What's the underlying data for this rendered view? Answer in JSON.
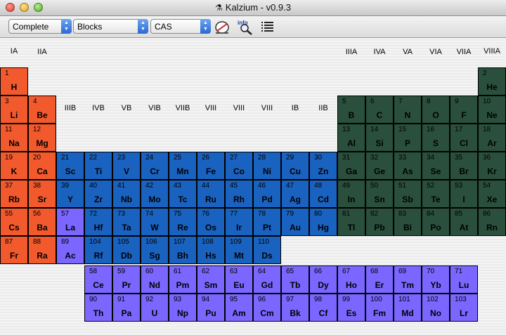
{
  "window": {
    "title": "Kalzium - v0.9.3"
  },
  "toolbar": {
    "select1": "Complete",
    "select2": "Blocks",
    "select3": "CAS",
    "icons": [
      "calculator-icon",
      "info-search-icon",
      "list-icon"
    ]
  },
  "groups": [
    {
      "label": "IA",
      "col": 1,
      "row": 0
    },
    {
      "label": "VIIIA",
      "col": 18,
      "row": 0
    },
    {
      "label": "IIA",
      "col": 2,
      "row": 1
    },
    {
      "label": "IIIA",
      "col": 13,
      "row": 1
    },
    {
      "label": "IVA",
      "col": 14,
      "row": 1
    },
    {
      "label": "VA",
      "col": 15,
      "row": 1
    },
    {
      "label": "VIA",
      "col": 16,
      "row": 1
    },
    {
      "label": "VIIA",
      "col": 17,
      "row": 1
    },
    {
      "label": "IIIB",
      "col": 3,
      "row": 3
    },
    {
      "label": "IVB",
      "col": 4,
      "row": 3
    },
    {
      "label": "VB",
      "col": 5,
      "row": 3
    },
    {
      "label": "VIB",
      "col": 6,
      "row": 3
    },
    {
      "label": "VIIB",
      "col": 7,
      "row": 3
    },
    {
      "label": "VIII",
      "col": 8,
      "row": 3
    },
    {
      "label": "VIII",
      "col": 9,
      "row": 3
    },
    {
      "label": "VIII",
      "col": 10,
      "row": 3
    },
    {
      "label": "IB",
      "col": 11,
      "row": 3
    },
    {
      "label": "IIB",
      "col": 12,
      "row": 3
    }
  ],
  "colors": {
    "s": "#f25a2e",
    "p": "#2a4f3d",
    "d": "#1a62c0",
    "f": "#7b66ff"
  },
  "elements": [
    {
      "n": "1",
      "s": "H",
      "c": 1,
      "r": 1,
      "b": "s"
    },
    {
      "n": "2",
      "s": "He",
      "c": 18,
      "r": 1,
      "b": "p"
    },
    {
      "n": "3",
      "s": "Li",
      "c": 1,
      "r": 2,
      "b": "s"
    },
    {
      "n": "4",
      "s": "Be",
      "c": 2,
      "r": 2,
      "b": "s"
    },
    {
      "n": "5",
      "s": "B",
      "c": 13,
      "r": 2,
      "b": "p"
    },
    {
      "n": "6",
      "s": "C",
      "c": 14,
      "r": 2,
      "b": "p"
    },
    {
      "n": "7",
      "s": "N",
      "c": 15,
      "r": 2,
      "b": "p"
    },
    {
      "n": "8",
      "s": "O",
      "c": 16,
      "r": 2,
      "b": "p"
    },
    {
      "n": "9",
      "s": "F",
      "c": 17,
      "r": 2,
      "b": "p"
    },
    {
      "n": "10",
      "s": "Ne",
      "c": 18,
      "r": 2,
      "b": "p"
    },
    {
      "n": "11",
      "s": "Na",
      "c": 1,
      "r": 3,
      "b": "s"
    },
    {
      "n": "12",
      "s": "Mg",
      "c": 2,
      "r": 3,
      "b": "s"
    },
    {
      "n": "13",
      "s": "Al",
      "c": 13,
      "r": 3,
      "b": "p"
    },
    {
      "n": "14",
      "s": "Si",
      "c": 14,
      "r": 3,
      "b": "p"
    },
    {
      "n": "15",
      "s": "P",
      "c": 15,
      "r": 3,
      "b": "p"
    },
    {
      "n": "16",
      "s": "S",
      "c": 16,
      "r": 3,
      "b": "p"
    },
    {
      "n": "17",
      "s": "Cl",
      "c": 17,
      "r": 3,
      "b": "p"
    },
    {
      "n": "18",
      "s": "Ar",
      "c": 18,
      "r": 3,
      "b": "p"
    },
    {
      "n": "19",
      "s": "K",
      "c": 1,
      "r": 4,
      "b": "s"
    },
    {
      "n": "20",
      "s": "Ca",
      "c": 2,
      "r": 4,
      "b": "s"
    },
    {
      "n": "21",
      "s": "Sc",
      "c": 3,
      "r": 4,
      "b": "d"
    },
    {
      "n": "22",
      "s": "Ti",
      "c": 4,
      "r": 4,
      "b": "d"
    },
    {
      "n": "23",
      "s": "V",
      "c": 5,
      "r": 4,
      "b": "d"
    },
    {
      "n": "24",
      "s": "Cr",
      "c": 6,
      "r": 4,
      "b": "d"
    },
    {
      "n": "25",
      "s": "Mn",
      "c": 7,
      "r": 4,
      "b": "d"
    },
    {
      "n": "26",
      "s": "Fe",
      "c": 8,
      "r": 4,
      "b": "d"
    },
    {
      "n": "27",
      "s": "Co",
      "c": 9,
      "r": 4,
      "b": "d"
    },
    {
      "n": "28",
      "s": "Ni",
      "c": 10,
      "r": 4,
      "b": "d"
    },
    {
      "n": "29",
      "s": "Cu",
      "c": 11,
      "r": 4,
      "b": "d"
    },
    {
      "n": "30",
      "s": "Zn",
      "c": 12,
      "r": 4,
      "b": "d"
    },
    {
      "n": "31",
      "s": "Ga",
      "c": 13,
      "r": 4,
      "b": "p"
    },
    {
      "n": "32",
      "s": "Ge",
      "c": 14,
      "r": 4,
      "b": "p"
    },
    {
      "n": "33",
      "s": "As",
      "c": 15,
      "r": 4,
      "b": "p"
    },
    {
      "n": "34",
      "s": "Se",
      "c": 16,
      "r": 4,
      "b": "p"
    },
    {
      "n": "35",
      "s": "Br",
      "c": 17,
      "r": 4,
      "b": "p"
    },
    {
      "n": "36",
      "s": "Kr",
      "c": 18,
      "r": 4,
      "b": "p"
    },
    {
      "n": "37",
      "s": "Rb",
      "c": 1,
      "r": 5,
      "b": "s"
    },
    {
      "n": "38",
      "s": "Sr",
      "c": 2,
      "r": 5,
      "b": "s"
    },
    {
      "n": "39",
      "s": "Y",
      "c": 3,
      "r": 5,
      "b": "d"
    },
    {
      "n": "40",
      "s": "Zr",
      "c": 4,
      "r": 5,
      "b": "d"
    },
    {
      "n": "41",
      "s": "Nb",
      "c": 5,
      "r": 5,
      "b": "d"
    },
    {
      "n": "42",
      "s": "Mo",
      "c": 6,
      "r": 5,
      "b": "d"
    },
    {
      "n": "43",
      "s": "Tc",
      "c": 7,
      "r": 5,
      "b": "d"
    },
    {
      "n": "44",
      "s": "Ru",
      "c": 8,
      "r": 5,
      "b": "d"
    },
    {
      "n": "45",
      "s": "Rh",
      "c": 9,
      "r": 5,
      "b": "d"
    },
    {
      "n": "46",
      "s": "Pd",
      "c": 10,
      "r": 5,
      "b": "d"
    },
    {
      "n": "47",
      "s": "Ag",
      "c": 11,
      "r": 5,
      "b": "d"
    },
    {
      "n": "48",
      "s": "Cd",
      "c": 12,
      "r": 5,
      "b": "d"
    },
    {
      "n": "49",
      "s": "In",
      "c": 13,
      "r": 5,
      "b": "p"
    },
    {
      "n": "50",
      "s": "Sn",
      "c": 14,
      "r": 5,
      "b": "p"
    },
    {
      "n": "51",
      "s": "Sb",
      "c": 15,
      "r": 5,
      "b": "p"
    },
    {
      "n": "52",
      "s": "Te",
      "c": 16,
      "r": 5,
      "b": "p"
    },
    {
      "n": "53",
      "s": "I",
      "c": 17,
      "r": 5,
      "b": "p"
    },
    {
      "n": "54",
      "s": "Xe",
      "c": 18,
      "r": 5,
      "b": "p"
    },
    {
      "n": "55",
      "s": "Cs",
      "c": 1,
      "r": 6,
      "b": "s"
    },
    {
      "n": "56",
      "s": "Ba",
      "c": 2,
      "r": 6,
      "b": "s"
    },
    {
      "n": "57",
      "s": "La",
      "c": 3,
      "r": 6,
      "b": "f"
    },
    {
      "n": "72",
      "s": "Hf",
      "c": 4,
      "r": 6,
      "b": "d"
    },
    {
      "n": "73",
      "s": "Ta",
      "c": 5,
      "r": 6,
      "b": "d"
    },
    {
      "n": "74",
      "s": "W",
      "c": 6,
      "r": 6,
      "b": "d"
    },
    {
      "n": "75",
      "s": "Re",
      "c": 7,
      "r": 6,
      "b": "d"
    },
    {
      "n": "76",
      "s": "Os",
      "c": 8,
      "r": 6,
      "b": "d"
    },
    {
      "n": "77",
      "s": "Ir",
      "c": 9,
      "r": 6,
      "b": "d"
    },
    {
      "n": "78",
      "s": "Pt",
      "c": 10,
      "r": 6,
      "b": "d"
    },
    {
      "n": "79",
      "s": "Au",
      "c": 11,
      "r": 6,
      "b": "d"
    },
    {
      "n": "80",
      "s": "Hg",
      "c": 12,
      "r": 6,
      "b": "d"
    },
    {
      "n": "81",
      "s": "Tl",
      "c": 13,
      "r": 6,
      "b": "p"
    },
    {
      "n": "82",
      "s": "Pb",
      "c": 14,
      "r": 6,
      "b": "p"
    },
    {
      "n": "83",
      "s": "Bi",
      "c": 15,
      "r": 6,
      "b": "p"
    },
    {
      "n": "84",
      "s": "Po",
      "c": 16,
      "r": 6,
      "b": "p"
    },
    {
      "n": "85",
      "s": "At",
      "c": 17,
      "r": 6,
      "b": "p"
    },
    {
      "n": "86",
      "s": "Rn",
      "c": 18,
      "r": 6,
      "b": "p"
    },
    {
      "n": "87",
      "s": "Fr",
      "c": 1,
      "r": 7,
      "b": "s"
    },
    {
      "n": "88",
      "s": "Ra",
      "c": 2,
      "r": 7,
      "b": "s"
    },
    {
      "n": "89",
      "s": "Ac",
      "c": 3,
      "r": 7,
      "b": "f"
    },
    {
      "n": "104",
      "s": "Rf",
      "c": 4,
      "r": 7,
      "b": "d"
    },
    {
      "n": "105",
      "s": "Db",
      "c": 5,
      "r": 7,
      "b": "d"
    },
    {
      "n": "106",
      "s": "Sg",
      "c": 6,
      "r": 7,
      "b": "d"
    },
    {
      "n": "107",
      "s": "Bh",
      "c": 7,
      "r": 7,
      "b": "d"
    },
    {
      "n": "108",
      "s": "Hs",
      "c": 8,
      "r": 7,
      "b": "d"
    },
    {
      "n": "109",
      "s": "Mt",
      "c": 9,
      "r": 7,
      "b": "d"
    },
    {
      "n": "110",
      "s": "Ds",
      "c": 10,
      "r": 7,
      "b": "d"
    },
    {
      "n": "58",
      "s": "Ce",
      "c": 4,
      "r": 8,
      "b": "f"
    },
    {
      "n": "59",
      "s": "Pr",
      "c": 5,
      "r": 8,
      "b": "f"
    },
    {
      "n": "60",
      "s": "Nd",
      "c": 6,
      "r": 8,
      "b": "f"
    },
    {
      "n": "61",
      "s": "Pm",
      "c": 7,
      "r": 8,
      "b": "f"
    },
    {
      "n": "62",
      "s": "Sm",
      "c": 8,
      "r": 8,
      "b": "f"
    },
    {
      "n": "63",
      "s": "Eu",
      "c": 9,
      "r": 8,
      "b": "f"
    },
    {
      "n": "64",
      "s": "Gd",
      "c": 10,
      "r": 8,
      "b": "f"
    },
    {
      "n": "65",
      "s": "Tb",
      "c": 11,
      "r": 8,
      "b": "f"
    },
    {
      "n": "66",
      "s": "Dy",
      "c": 12,
      "r": 8,
      "b": "f"
    },
    {
      "n": "67",
      "s": "Ho",
      "c": 13,
      "r": 8,
      "b": "f"
    },
    {
      "n": "68",
      "s": "Er",
      "c": 14,
      "r": 8,
      "b": "f"
    },
    {
      "n": "69",
      "s": "Tm",
      "c": 15,
      "r": 8,
      "b": "f"
    },
    {
      "n": "70",
      "s": "Yb",
      "c": 16,
      "r": 8,
      "b": "f"
    },
    {
      "n": "71",
      "s": "Lu",
      "c": 17,
      "r": 8,
      "b": "f"
    },
    {
      "n": "90",
      "s": "Th",
      "c": 4,
      "r": 9,
      "b": "f"
    },
    {
      "n": "91",
      "s": "Pa",
      "c": 5,
      "r": 9,
      "b": "f"
    },
    {
      "n": "92",
      "s": "U",
      "c": 6,
      "r": 9,
      "b": "f"
    },
    {
      "n": "93",
      "s": "Np",
      "c": 7,
      "r": 9,
      "b": "f"
    },
    {
      "n": "94",
      "s": "Pu",
      "c": 8,
      "r": 9,
      "b": "f"
    },
    {
      "n": "95",
      "s": "Am",
      "c": 9,
      "r": 9,
      "b": "f"
    },
    {
      "n": "96",
      "s": "Cm",
      "c": 10,
      "r": 9,
      "b": "f"
    },
    {
      "n": "97",
      "s": "Bk",
      "c": 11,
      "r": 9,
      "b": "f"
    },
    {
      "n": "98",
      "s": "Cf",
      "c": 12,
      "r": 9,
      "b": "f"
    },
    {
      "n": "99",
      "s": "Es",
      "c": 13,
      "r": 9,
      "b": "f"
    },
    {
      "n": "100",
      "s": "Fm",
      "c": 14,
      "r": 9,
      "b": "f"
    },
    {
      "n": "101",
      "s": "Md",
      "c": 15,
      "r": 9,
      "b": "f"
    },
    {
      "n": "102",
      "s": "No",
      "c": 16,
      "r": 9,
      "b": "f"
    },
    {
      "n": "103",
      "s": "Lr",
      "c": 17,
      "r": 9,
      "b": "f"
    }
  ]
}
